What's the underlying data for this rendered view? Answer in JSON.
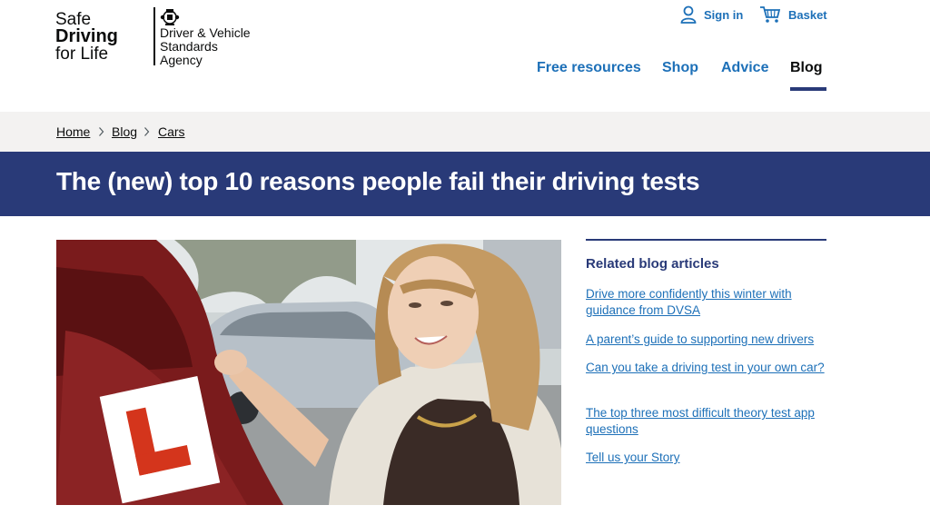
{
  "header": {
    "logo_line1": "Safe",
    "logo_line2": "Driving",
    "logo_line3": "for Life",
    "agency_line1": "Driver & Vehicle",
    "agency_line2": "Standards",
    "agency_line3": "Agency",
    "signin_label": "Sign in",
    "basket_label": "Basket"
  },
  "nav": {
    "items": [
      {
        "label": "Free resources"
      },
      {
        "label": "Shop"
      },
      {
        "label": "Advice"
      },
      {
        "label": "Blog",
        "active": true
      }
    ]
  },
  "breadcrumb": [
    "Home",
    "Blog",
    "Cars"
  ],
  "article": {
    "title": "The (new) top 10 reasons people fail their driving tests"
  },
  "sidebar": {
    "heading": "Related blog articles",
    "links": [
      "Drive more confidently this winter with guidance from DVSA",
      "A parent’s guide to supporting new drivers",
      "Can you take a driving test in your own car?",
      "The top three most difficult theory test app questions",
      "Tell us your Story"
    ]
  },
  "colors": {
    "brand_navy": "#293a78",
    "link_blue": "#1d70b8",
    "breadcrumb_bg": "#f3f2f1",
    "l_plate_red": "#d4351c"
  },
  "icons": [
    "crest-icon",
    "user-icon",
    "basket-icon",
    "chevron-right-icon"
  ]
}
